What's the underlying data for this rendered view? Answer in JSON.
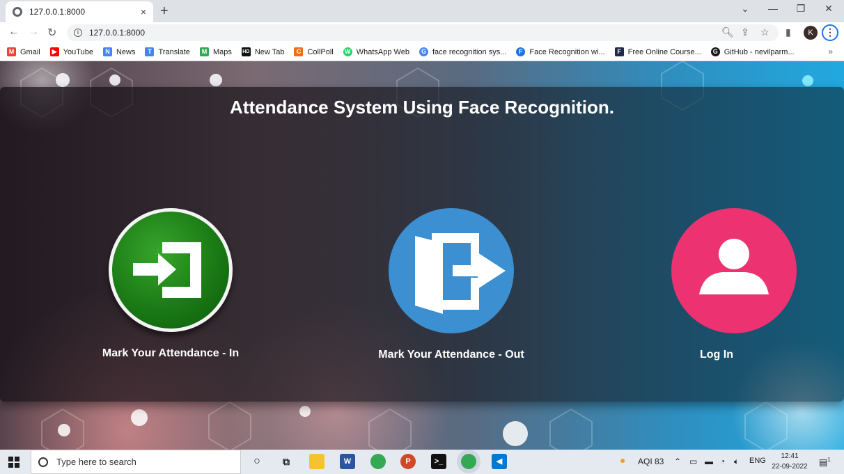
{
  "browser": {
    "tab_title": "127.0.0.1:8000",
    "tab_close": "×",
    "new_tab": "+",
    "url": "127.0.0.1:8000",
    "profile_initial": "K",
    "window_controls": [
      "⌄",
      "—",
      "❐",
      "✕"
    ],
    "nav_icons": [
      "←",
      "→",
      "↻"
    ],
    "menu_glyph": "⋮"
  },
  "bookmarks": [
    {
      "label": "Gmail",
      "icon": "gmail-icon",
      "color": "#ea4335",
      "glyph": "M"
    },
    {
      "label": "YouTube",
      "icon": "youtube-icon",
      "color": "#ff0000",
      "glyph": "▶"
    },
    {
      "label": "News",
      "icon": "news-icon",
      "color": "#4285f4",
      "glyph": "N"
    },
    {
      "label": "Translate",
      "icon": "translate-icon",
      "color": "#4285f4",
      "glyph": "T"
    },
    {
      "label": "Maps",
      "icon": "maps-icon",
      "color": "#34a853",
      "glyph": "M"
    },
    {
      "label": "New Tab",
      "icon": "hd-icon",
      "color": "#111111",
      "glyph": "HD"
    },
    {
      "label": "CollPoll",
      "icon": "collpoll-icon",
      "color": "#e8711c",
      "glyph": "C"
    },
    {
      "label": "WhatsApp Web",
      "icon": "whatsapp-icon",
      "color": "#25d366",
      "glyph": "W"
    },
    {
      "label": "face recognition sys...",
      "icon": "google-icon",
      "color": "#4285f4",
      "glyph": "G"
    },
    {
      "label": "Face Recognition wi...",
      "icon": "link-icon",
      "color": "#1a73e8",
      "glyph": "F"
    },
    {
      "label": "Free Online Course...",
      "icon": "course-icon",
      "color": "#1f2a44",
      "glyph": "F"
    },
    {
      "label": "GitHub - nevilparm...",
      "icon": "github-icon",
      "color": "#181717",
      "glyph": "G"
    }
  ],
  "bookmarks_more": "»",
  "page": {
    "title": "Attendance System Using Face Recognition.",
    "actions": [
      {
        "label": "Mark Your Attendance - In",
        "icon": "sign-in-icon",
        "color": "#1a7a15"
      },
      {
        "label": "Mark Your Attendance - Out",
        "icon": "sign-out-icon",
        "color": "#3c8fd1"
      },
      {
        "label": "Log In",
        "icon": "user-icon",
        "color": "#ec3270"
      }
    ]
  },
  "taskbar": {
    "search_placeholder": "Type here to search",
    "aqi": "AQI 83",
    "language": "ENG",
    "time": "12:41",
    "date": "22-09-2022",
    "notification_count": "1"
  }
}
